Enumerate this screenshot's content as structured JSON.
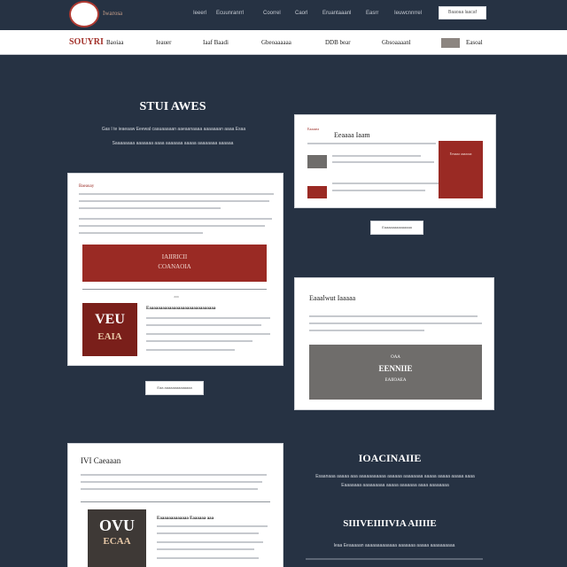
{
  "header": {
    "brand": "Iwarosa",
    "nav": [
      "Ieeerl",
      "Ecuunranrrl",
      "Coorrel",
      "Caorl",
      "Eruantaaanl",
      "Easrr",
      "Ieuwcnnrrel"
    ],
    "cta_label": "Baaoaa laacaf"
  },
  "navbar": {
    "brand": "SOUYRI",
    "items": [
      "Baoiaa",
      "Ieauer",
      "Iaaf Baadi",
      "Gbeoaaaaaa",
      "DDB bear",
      "Gbsoaaaanl",
      "Easoal"
    ]
  },
  "hero": {
    "title": "STUI AWES",
    "line1": "Gas I te ieaeaaw Eeewal caauaaaaan aaeaanaaaa aaaaaaan aaaa Esaa",
    "line2": "Saaaaaaaa aaaaaaa aaaa aaaaaaa aaaaa aaaaaaaa aaaaaa"
  },
  "card_main": {
    "title": "Baeauay",
    "cta_line1": "IAIIRICII",
    "cta_line2": "COANAOIA",
    "divider_label": "aaa",
    "thumb_line1": "VEU",
    "thumb_line2": "EAIA",
    "item_title": "Eaaaaaaaaaaaaaaaaaaaaaaaaaaaaaa"
  },
  "button_main": "Eaa aaaaaaaaaaaaaa",
  "card_right1": {
    "kicker": "Eaaaaea",
    "title": "Eeaaaa Iaam",
    "thumb_label": "Eeaaaa aaaaaaa"
  },
  "button_right1": "Eaaaaaaaaaaaaaa",
  "card_right2": {
    "title": "Eaaalwut Iaaaaa",
    "panel_line1": "OAA",
    "panel_line2": "EENNIIE",
    "panel_line3": "EAIIOAEA"
  },
  "card_bottom": {
    "title": "IVI Caeaaan",
    "thumb_line1": "OVU",
    "thumb_line2": "ECAA",
    "item_title": "Eaaaaaaaaaaaaa Eaaaaaa aaa"
  },
  "section2": {
    "title": "IOACINAIIE",
    "line1": "Esaanaaa aaaaa aaa aaaaaaaaaaa aaaaaa aaaaaaaa aaaaa aaaaa aaaaa aaaa",
    "line2": "Eaaaaaaa aaaaaaaaa aaaaa aaaaaaa aaaa aaaaaaaa"
  },
  "section3": {
    "title": "SIIIVEIIIIVIA AIIIIE",
    "line1": "Ieaa Eeaaaaan aaaaaaaaaaaaa aaaaaaa aaaaa aaaaaaaaaa"
  },
  "colors": {
    "background": "#263243",
    "accent_red": "#9a2a24",
    "card": "#ffffff"
  }
}
